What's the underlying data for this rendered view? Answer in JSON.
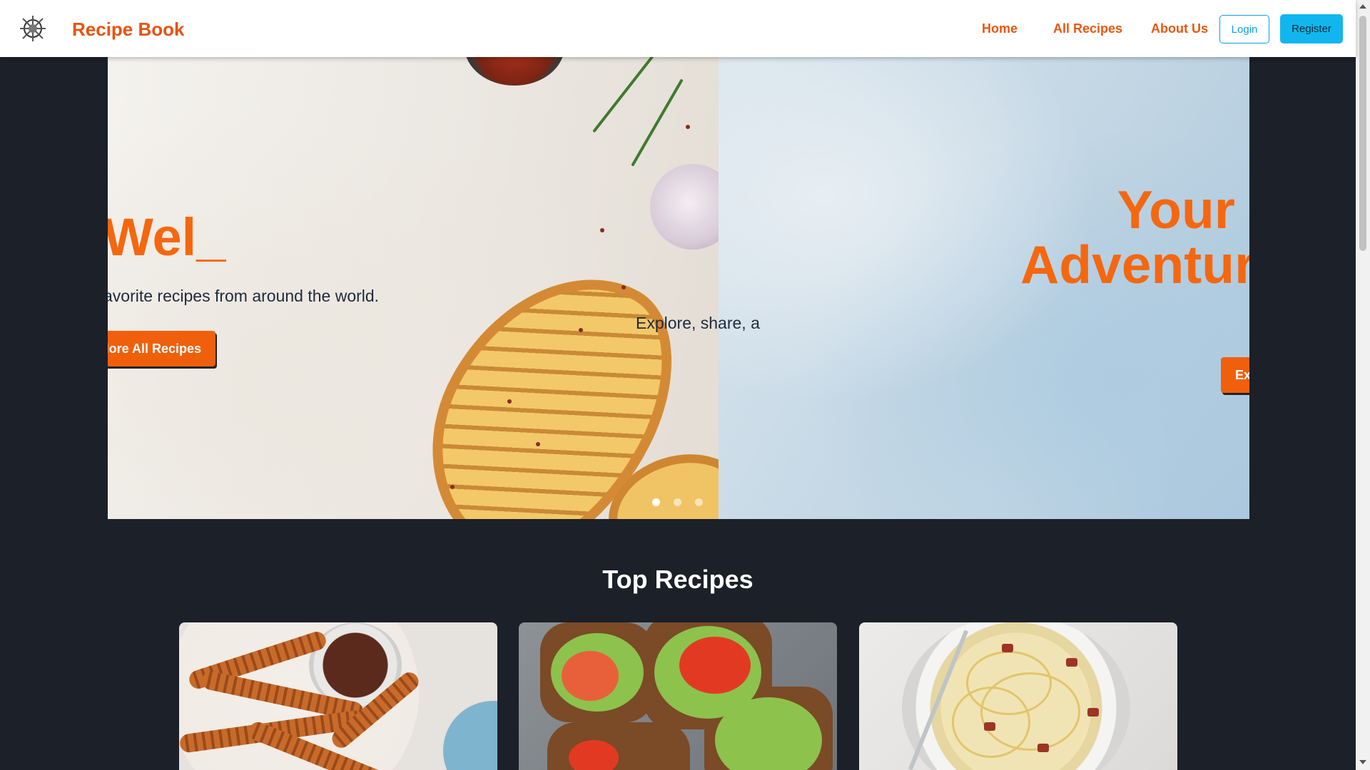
{
  "navbar": {
    "brand": "Recipe Book",
    "links": [
      "Home",
      "All Recipes",
      "About Us"
    ],
    "login": "Login",
    "register": "Register"
  },
  "hero": {
    "slides": [
      {
        "title": "Wel_",
        "subtitle": "avorite recipes from around the world.",
        "button": "plore All Recipes"
      },
      {
        "title_line1": "Your",
        "title_line2": "Adventure",
        "subtitle": "Explore, share, a",
        "button": "Ex"
      }
    ],
    "dots": 3,
    "active_dot": 0
  },
  "top_recipes": {
    "title": "Top Recipes",
    "cards": [
      "churros",
      "avocado-toast",
      "spaghetti-carbonara"
    ]
  },
  "colors": {
    "accent": "#f5670f",
    "brand": "#e8520f",
    "register_bg": "#11b6ee",
    "background": "#1b2029"
  }
}
